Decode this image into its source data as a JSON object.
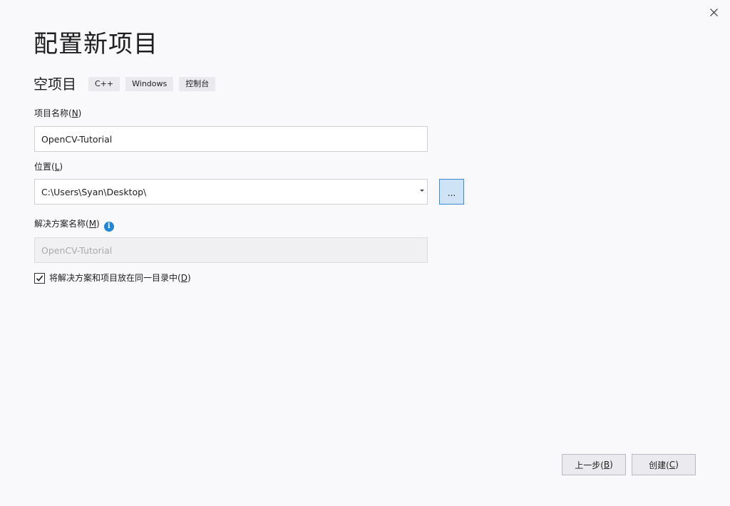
{
  "window": {
    "close_icon": "close-icon"
  },
  "header": {
    "title": "配置新项目"
  },
  "template": {
    "name": "空项目",
    "tags": [
      "C++",
      "Windows",
      "控制台"
    ]
  },
  "project_name": {
    "label": "项目名称(",
    "label_key": "N",
    "label_end": ")",
    "value": "OpenCV-Tutorial"
  },
  "location": {
    "label": "位置(",
    "label_key": "L",
    "label_end": ")",
    "value": "C:\\Users\\Syan\\Desktop\\",
    "browse_label": "..."
  },
  "solution_name": {
    "label": "解决方案名称(",
    "label_key": "M",
    "label_end": ")",
    "info_icon": "info-icon",
    "value": "OpenCV-Tutorial",
    "enabled": false
  },
  "same_directory": {
    "label": "将解决方案和项目放在同一目录中(",
    "label_key": "D",
    "label_end": ")",
    "checked": true
  },
  "footer": {
    "back_label": "上一步(",
    "back_key": "B",
    "back_end": ")",
    "create_label": "创建(",
    "create_key": "C",
    "create_end": ")"
  }
}
